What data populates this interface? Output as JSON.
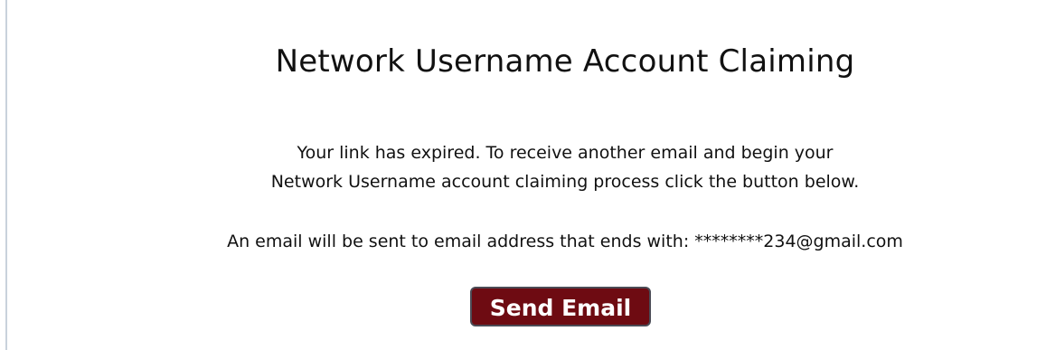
{
  "page": {
    "title": "Network Username Account Claiming",
    "message_line1": "Your link has expired. To receive another email and begin your",
    "message_line2": "Network Username account claiming process click the button below.",
    "email_notice": "An email will be sent to email address that ends with: ********234@gmail.com",
    "send_button_label": "Send Email"
  },
  "colors": {
    "button_background": "#6e0b12",
    "button_text": "#ffffff",
    "left_rule": "#c9d2dc"
  }
}
